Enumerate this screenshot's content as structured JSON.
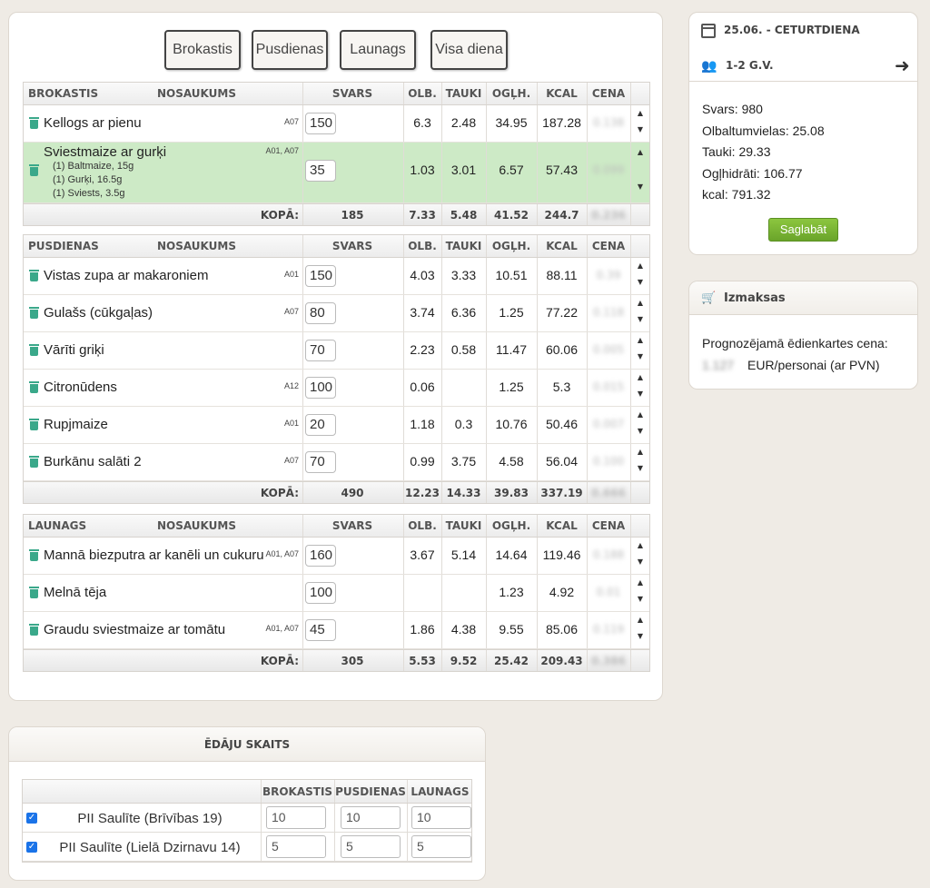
{
  "tabs": [
    "Brokastis",
    "Pusdienas",
    "Launags",
    "Visa diena"
  ],
  "columns": {
    "name": "NOSAUKUMS",
    "svars": "SVARS",
    "olb": "OLB.",
    "tauki": "TAUKI",
    "oglh": "OGĻH.",
    "kcal": "KCAL",
    "cena": "CENA"
  },
  "total_label": "KOPĀ:",
  "meals": [
    {
      "title": "BROKASTIS",
      "items": [
        {
          "name": "Kellogs ar pienu",
          "allergens": "A07",
          "weight": "150",
          "olb": "6.3",
          "tauki": "2.48",
          "oglh": "34.95",
          "kcal": "187.28",
          "price": "0.138"
        },
        {
          "name": "Sviestmaize ar gurķi",
          "allergens": "A01, A07",
          "weight": "35",
          "olb": "1.03",
          "tauki": "3.01",
          "oglh": "6.57",
          "kcal": "57.43",
          "price": "0.099",
          "sub": [
            "(1) Baltmaize, 15g",
            "(1) Gurķi, 16.5g",
            "(1) Sviests, 3.5g"
          ]
        }
      ],
      "total": {
        "svars": "185",
        "olb": "7.33",
        "tauki": "5.48",
        "oglh": "41.52",
        "kcal": "244.7",
        "price": "0.236"
      }
    },
    {
      "title": "PUSDIENAS",
      "items": [
        {
          "name": "Vistas zupa ar makaroniem",
          "allergens": "A01",
          "weight": "150",
          "olb": "4.03",
          "tauki": "3.33",
          "oglh": "10.51",
          "kcal": "88.11",
          "price": "0.39"
        },
        {
          "name": "Gulašs (cūkgaļas)",
          "allergens": "A07",
          "weight": "80",
          "olb": "3.74",
          "tauki": "6.36",
          "oglh": "1.25",
          "kcal": "77.22",
          "price": "0.118"
        },
        {
          "name": "Vārīti griķi",
          "allergens": "",
          "weight": "70",
          "olb": "2.23",
          "tauki": "0.58",
          "oglh": "11.47",
          "kcal": "60.06",
          "price": "0.005"
        },
        {
          "name": "Citronūdens",
          "allergens": "A12",
          "weight": "100",
          "olb": "0.06",
          "tauki": "",
          "oglh": "1.25",
          "kcal": "5.3",
          "price": "0.015"
        },
        {
          "name": "Rupjmaize",
          "allergens": "A01",
          "weight": "20",
          "olb": "1.18",
          "tauki": "0.3",
          "oglh": "10.76",
          "kcal": "50.46",
          "price": "0.007"
        },
        {
          "name": "Burkānu salāti 2",
          "allergens": "A07",
          "weight": "70",
          "olb": "0.99",
          "tauki": "3.75",
          "oglh": "4.58",
          "kcal": "56.04",
          "price": "0.100"
        }
      ],
      "total": {
        "svars": "490",
        "olb": "12.23",
        "tauki": "14.33",
        "oglh": "39.83",
        "kcal": "337.19",
        "price": "0.666"
      }
    },
    {
      "title": "LAUNAGS",
      "items": [
        {
          "name": "Mannā biezputra ar kanēli un cukuru",
          "allergens": "A01, A07",
          "weight": "160",
          "olb": "3.67",
          "tauki": "5.14",
          "oglh": "14.64",
          "kcal": "119.46",
          "price": "0.188"
        },
        {
          "name": "Melnā tēja",
          "allergens": "",
          "weight": "100",
          "olb": "",
          "tauki": "",
          "oglh": "1.23",
          "kcal": "4.92",
          "price": "0.01"
        },
        {
          "name": "Graudu sviestmaize ar tomātu",
          "allergens": "A01, A07",
          "weight": "45",
          "olb": "1.86",
          "tauki": "4.38",
          "oglh": "9.55",
          "kcal": "85.06",
          "price": "0.119"
        }
      ],
      "total": {
        "svars": "305",
        "olb": "5.53",
        "tauki": "9.52",
        "oglh": "25.42",
        "kcal": "209.43",
        "price": "0.386"
      }
    }
  ],
  "summary": {
    "date": "25.06. - CETURTDIENA",
    "group": "1-2 G.V.",
    "svars": "Svars: 980",
    "olb": "Olbaltumvielas: 25.08",
    "tauki": "Tauki: 29.33",
    "oglh": "Ogļhidrāti: 106.77",
    "kcal": "kcal: 791.32",
    "save": "Saglabāt"
  },
  "costs": {
    "title": "Izmaksas",
    "label": "Prognozējamā ēdienkartes cena:",
    "value": "1.127",
    "unit": "EUR/personai (ar PVN)"
  },
  "counts": {
    "title": "ĒDĀJU SKAITS",
    "headers": [
      "BROKASTIS",
      "PUSDIENAS",
      "LAUNAGS"
    ],
    "rows": [
      {
        "name": "PII Saulīte (Brīvības 19)",
        "values": [
          "10",
          "10",
          "10"
        ]
      },
      {
        "name": "PII Saulīte (Lielā Dzirnavu 14)",
        "values": [
          "5",
          "5",
          "5"
        ]
      }
    ]
  }
}
